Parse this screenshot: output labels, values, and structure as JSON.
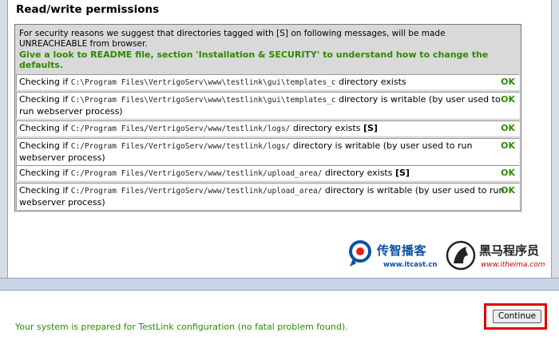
{
  "section": {
    "title": "Read/write permissions"
  },
  "intro": {
    "line1": "For security reasons we suggest that directories tagged with [S] on following messages, will be made UNREACHEABLE from browser.",
    "line2": "Give a look to README file, section 'Installation & SECURITY' to understand how to change the defaults."
  },
  "checks": [
    {
      "prefix": "Checking if ",
      "path": "C:\\Program Files\\VertrigoServ\\www\\testlink\\gui\\templates_c",
      "suffix": " directory exists",
      "tag": "",
      "status": "OK"
    },
    {
      "prefix": "Checking if ",
      "path": "C:\\Program Files\\VertrigoServ\\www\\testlink\\gui\\templates_c",
      "suffix": " directory is writable (by user used to run webserver process)",
      "tag": "",
      "status": "OK"
    },
    {
      "prefix": "Checking if ",
      "path": "C:/Program Files/VertrigoServ/www/testlink/logs/",
      "suffix": " directory exists ",
      "tag": "[S]",
      "status": "OK"
    },
    {
      "prefix": "Checking if ",
      "path": "C:/Program Files/VertrigoServ/www/testlink/logs/",
      "suffix": " directory is writable (by user used to run webserver process)",
      "tag": "",
      "status": "OK"
    },
    {
      "prefix": "Checking if ",
      "path": "C:/Program Files/VertrigoServ/www/testlink/upload_area/",
      "suffix": " directory exists ",
      "tag": "[S]",
      "status": "OK"
    },
    {
      "prefix": "Checking if ",
      "path": "C:/Program Files/VertrigoServ/www/testlink/upload_area/",
      "suffix": " directory is writable (by user used to run webserver process)",
      "tag": "",
      "status": "OK"
    }
  ],
  "logos": {
    "itcast_cn": "传智播客",
    "itcast_url": "www.itcast.cn",
    "itheima_cn": "黑马程序员",
    "itheima_url": "www.itheima.com"
  },
  "footer": {
    "ready_message": "Your system is prepared for TestLink configuration (no fatal problem found).",
    "continue_label": "Continue"
  },
  "colors": {
    "ok_green": "#2e8b00",
    "highlight_red": "#e00000",
    "panel_gray": "#d9d9d9"
  }
}
